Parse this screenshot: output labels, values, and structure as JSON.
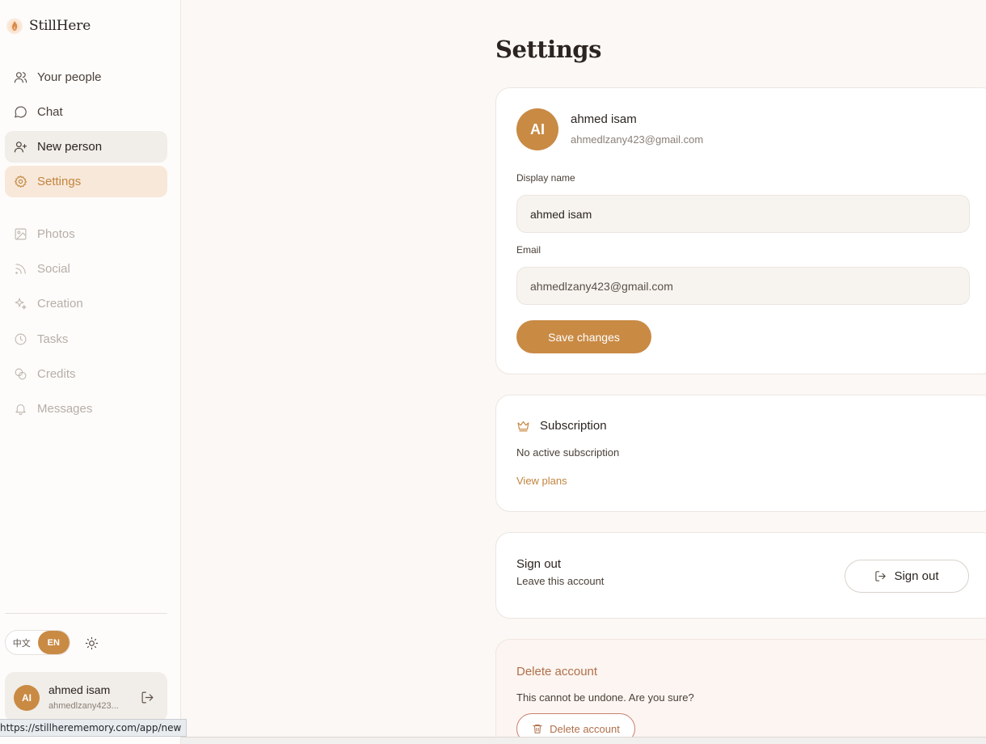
{
  "app": {
    "brand_name": "StillHere"
  },
  "sidebar": {
    "items": [
      {
        "label": "Your people",
        "icon": "users-icon",
        "state": "normal"
      },
      {
        "label": "Chat",
        "icon": "chat-bubble-icon",
        "state": "normal"
      },
      {
        "label": "New person",
        "icon": "user-plus-icon",
        "state": "hover"
      },
      {
        "label": "Settings",
        "icon": "gear-icon",
        "state": "selected"
      },
      {
        "label": "Photos",
        "icon": "image-icon",
        "state": "disabled"
      },
      {
        "label": "Social",
        "icon": "rss-icon",
        "state": "disabled"
      },
      {
        "label": "Creation",
        "icon": "sparkles-icon",
        "state": "disabled"
      },
      {
        "label": "Tasks",
        "icon": "clock-icon",
        "state": "disabled"
      },
      {
        "label": "Credits",
        "icon": "coins-icon",
        "state": "disabled"
      },
      {
        "label": "Messages",
        "icon": "bell-icon",
        "state": "disabled"
      }
    ],
    "language": {
      "options": [
        "中文",
        "EN"
      ],
      "selected": "EN"
    },
    "theme_icon": "sun-icon",
    "user": {
      "initials": "AI",
      "name": "ahmed isam",
      "email_truncated": "ahmedlzany423..."
    }
  },
  "main": {
    "title": "Settings",
    "profile": {
      "initials": "AI",
      "name": "ahmed isam",
      "email": "ahmedlzany423@gmail.com",
      "display_name_label": "Display name",
      "display_name_value": "ahmed isam",
      "email_label": "Email",
      "email_value": "ahmedlzany423@gmail.com",
      "save_label": "Save changes"
    },
    "subscription": {
      "title": "Subscription",
      "status": "No active subscription",
      "link": "View plans"
    },
    "signout": {
      "title": "Sign out",
      "description": "Leave this account",
      "button_label": "Sign out"
    },
    "danger": {
      "title": "Delete account",
      "description": "This cannot be undone. Are you sure?",
      "button_label": "Delete account"
    }
  },
  "status_bar": {
    "url": "https://stillherememory.com/app/new"
  },
  "colors": {
    "accent": "#c98a44",
    "selected_bg": "#f8e8d9",
    "danger_text": "#b0704a"
  }
}
